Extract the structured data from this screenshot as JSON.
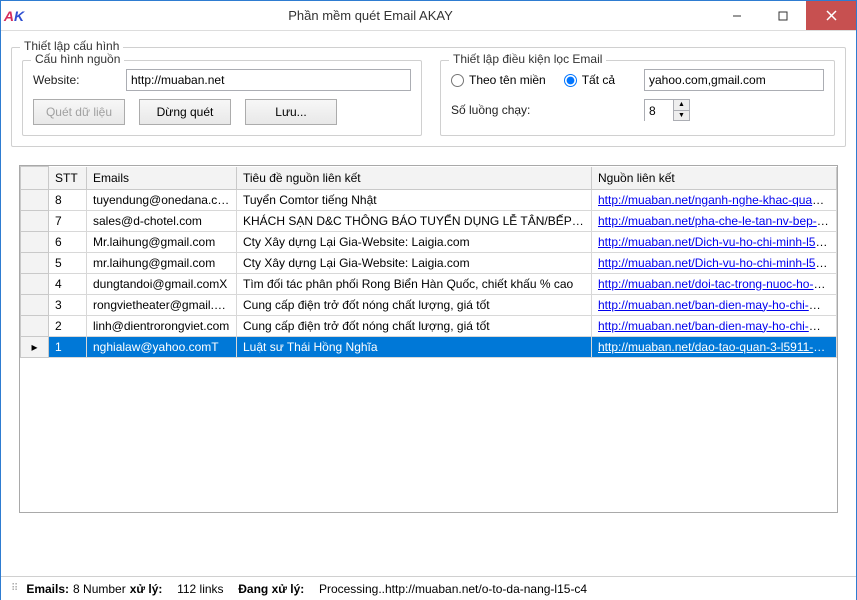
{
  "window": {
    "title": "Phần mềm quét Email AKAY"
  },
  "config": {
    "group_label": "Thiết lập cấu hình",
    "source": {
      "legend": "Cấu hình nguồn",
      "website_label": "Website:",
      "website_value": "http://muaban.net",
      "btn_scan": "Quét dữ liệu",
      "btn_stop": "Dừng quét",
      "btn_save": "Lưu..."
    },
    "filter": {
      "legend": "Thiết lập điều kiện lọc Email",
      "radio_domain": "Theo tên miền",
      "radio_all": "Tất cả",
      "domains_value": "yahoo.com,gmail.com",
      "threads_label": "Số luồng chạy:",
      "threads_value": "8"
    }
  },
  "grid": {
    "headers": {
      "stt": "STT",
      "emails": "Emails",
      "title": "Tiêu đề nguồn liên kết",
      "link": "Nguồn liên kết"
    },
    "rows": [
      {
        "stt": "8",
        "email": "tuyendung@onedana.com",
        "title": "Tuyển Comtor tiếng Nhật",
        "link": "http://muaban.net/nganh-nghe-khac-quan-son-tr..."
      },
      {
        "stt": "7",
        "email": "sales@d-chotel.com",
        "title": "KHÁCH SẠN D&C THÔNG BÁO TUYỂN DỤNG LỄ TÂN/BẾP/BUỒ...",
        "link": "http://muaban.net/pha-che-le-tan-nv-bep-nh-ks-d..."
      },
      {
        "stt": "6",
        "email": "Mr.laihung@gmail.com",
        "title": "Cty Xây dựng Lại Gia-Website: Laigia.com",
        "link": "http://muaban.net/Dich-vu-ho-chi-minh-l59-c9"
      },
      {
        "stt": "5",
        "email": "mr.laihung@gmail.com",
        "title": "Cty Xây dựng Lại Gia-Website: Laigia.com",
        "link": "http://muaban.net/Dich-vu-ho-chi-minh-l59-c9"
      },
      {
        "stt": "4",
        "email": "dungtandoi@gmail.comX",
        "title": "Tìm đối tác phân phối Rong Biển Hàn Quốc, chiết khấu % cao",
        "link": "http://muaban.net/doi-tac-trong-nuoc-ho-chi-minh..."
      },
      {
        "stt": "3",
        "email": "rongvietheater@gmail.co...",
        "title": "Cung cấp điện trở đốt nóng chất lượng, giá tốt",
        "link": "http://muaban.net/ban-dien-may-ho-chi-minh-l59-..."
      },
      {
        "stt": "2",
        "email": "linh@dientrorongviet.com",
        "title": "Cung cấp điện trở đốt nóng chất lượng, giá tốt",
        "link": "http://muaban.net/ban-dien-may-ho-chi-minh-l59-..."
      },
      {
        "stt": "1",
        "email": "nghialaw@yahoo.comT",
        "title": "Luật sư Thái Hồng Nghĩa",
        "link": "http://muaban.net/dao-tao-quan-3-l5911-c22/lua...",
        "selected": true
      }
    ]
  },
  "status": {
    "emails_label": "Emails:",
    "emails_value": "8 Number",
    "processed_label": "xử lý:",
    "processed_value": "112 links",
    "processing_label": "Đang xử lý:",
    "processing_value": "Processing..http://muaban.net/o-to-da-nang-l15-c4"
  }
}
